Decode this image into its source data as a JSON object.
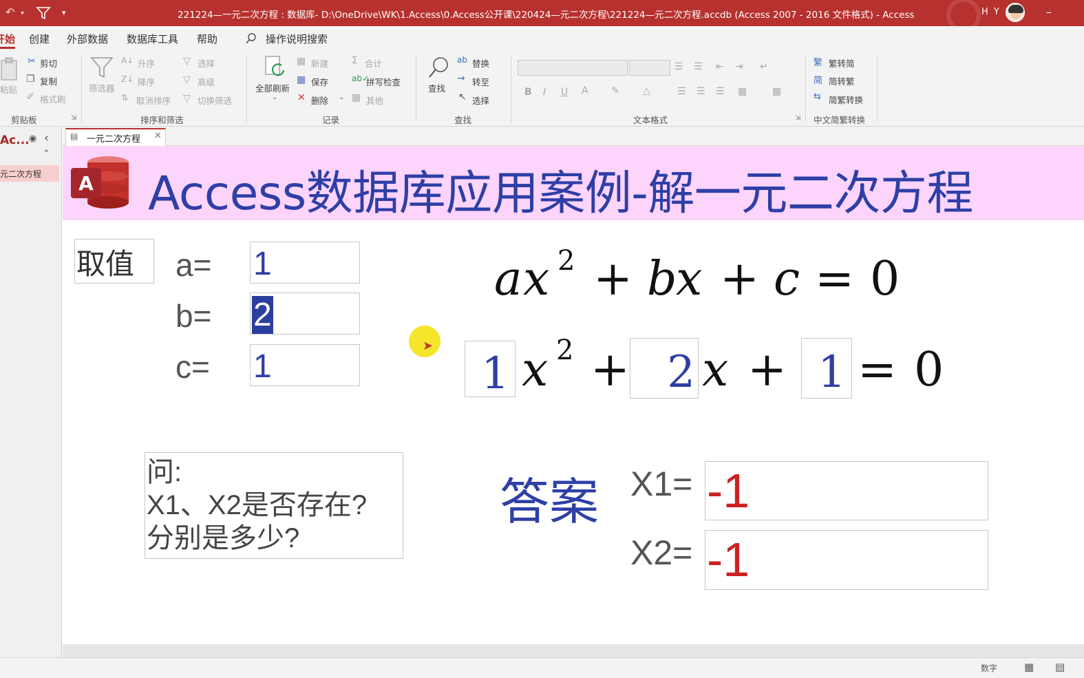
{
  "window": {
    "title": "221224—一元二次方程 : 数据库- D:\\OneDrive\\WK\\1.Access\\0.Access公开课\\220424—元二次方程\\221224—元二次方程.accdb (Access 2007 - 2016 文件格式) - Access",
    "user_initials": "H Y",
    "minimize": "–"
  },
  "menu": {
    "home": "开始",
    "create": "创建",
    "external_data": "外部数据",
    "db_tools": "数据库工具",
    "help": "帮助",
    "tell_me": "操作说明搜索"
  },
  "ribbon": {
    "clipboard": {
      "paste": "粘贴",
      "cut": "剪切",
      "copy": "复制",
      "format_painter": "格式刷",
      "label": "剪贴板"
    },
    "sort_filter": {
      "filter": "筛选器",
      "ascending": "升序",
      "descending": "降序",
      "remove_sort": "取消排序",
      "selection": "选择",
      "advanced": "高级",
      "toggle_filter": "切换筛选",
      "label": "排序和筛选"
    },
    "records": {
      "refresh_all": "全部刷新",
      "new": "新建",
      "save": "保存",
      "delete": "删除",
      "totals": "合计",
      "spelling": "拼写检查",
      "more": "其他",
      "label": "记录"
    },
    "find": {
      "find": "查找",
      "replace": "替换",
      "goto": "转至",
      "select": "选择",
      "label": "查找"
    },
    "text_format": {
      "bold": "B",
      "italic": "I",
      "underline": "U",
      "label": "文本格式"
    },
    "chinese_conversion": {
      "to_simplified": "繁转简",
      "to_traditional": "简转繁",
      "convert": "简繁转换",
      "label": "中文简繁转换"
    }
  },
  "nav": {
    "title": "Ac...",
    "item": "一元二次方程"
  },
  "doc_tab": {
    "label": "一元二次方程"
  },
  "form": {
    "title": "Access数据库应用案例-解一元二次方程",
    "values_label": "取值",
    "a_label": "a=",
    "b_label": "b=",
    "c_label": "c=",
    "a_value": "1",
    "b_value": "2",
    "c_value": "1",
    "formula": {
      "a": "a",
      "x": "x",
      "sq": "2",
      "plus1": "+",
      "b": "b",
      "x2": "x",
      "plus2": "+",
      "c": "c",
      "eq": "=",
      "zero": "0"
    },
    "formula_filled": {
      "x": "x",
      "sq": "2",
      "plus1": "+",
      "x2": "x",
      "plus2": "+",
      "eq": "=",
      "zero": "0"
    },
    "question": [
      "问:",
      "X1、X2是否存在?",
      "分别是多少?"
    ],
    "answer_label": "答案",
    "x1_label": "X1=",
    "x2_label": "X2=",
    "x1_value": "-1",
    "x2_value": "-1"
  },
  "status": {
    "mode": "数字"
  },
  "colors": {
    "title_bar": "#b7312e",
    "form_header": "#fcd4fc",
    "title_text": "#2e3fa6",
    "answer_value": "#cc2222"
  }
}
